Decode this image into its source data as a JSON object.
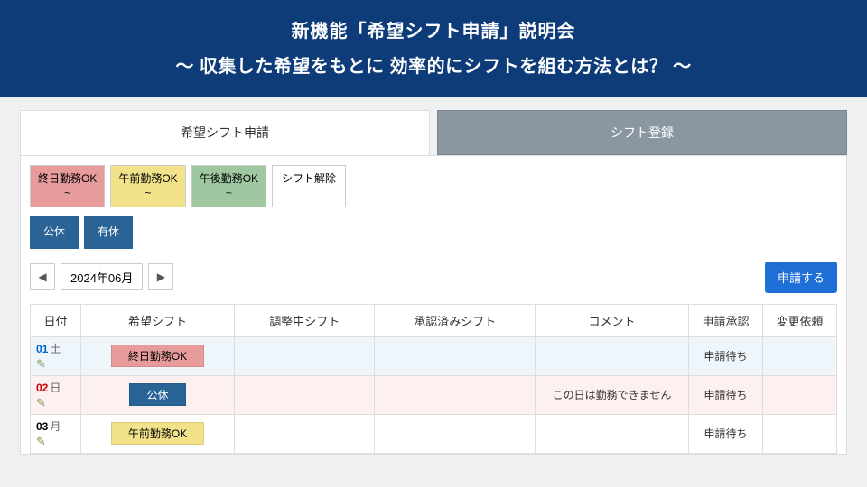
{
  "banner": {
    "title1": "新機能「希望シフト申請」説明会",
    "title2": "〜 収集した希望をもとに 効率的にシフトを組む方法とは？ 〜"
  },
  "tabs": {
    "active": "希望シフト申請",
    "inactive": "シフト登録"
  },
  "chips": {
    "allday": "終日勤務OK\n~",
    "am": "午前勤務OK\n~",
    "pm": "午後勤務OK\n~",
    "clear": "シフト解除",
    "public_holiday": "公休",
    "paid_leave": "有休"
  },
  "nav": {
    "month": "2024年06月",
    "apply": "申請する"
  },
  "table": {
    "headers": {
      "date": "日付",
      "desired": "希望シフト",
      "adjusting": "調整中シフト",
      "approved": "承認済みシフト",
      "comment": "コメント",
      "approval": "申請承認",
      "change": "変更依頼"
    },
    "rows": [
      {
        "num": "01",
        "dow": "土",
        "dowClass": "sat",
        "rowClass": "row-sat",
        "badge": "終日勤務OK",
        "badgeClass": "red",
        "comment": "",
        "status": "申請待ち"
      },
      {
        "num": "02",
        "dow": "日",
        "dowClass": "sun",
        "rowClass": "row-sun",
        "badge": "公休",
        "badgeClass": "blue",
        "comment": "この日は勤務できません",
        "status": "申請待ち"
      },
      {
        "num": "03",
        "dow": "月",
        "dowClass": "",
        "rowClass": "",
        "badge": "午前勤務OK",
        "badgeClass": "yellow",
        "comment": "",
        "status": "申請待ち"
      }
    ]
  }
}
